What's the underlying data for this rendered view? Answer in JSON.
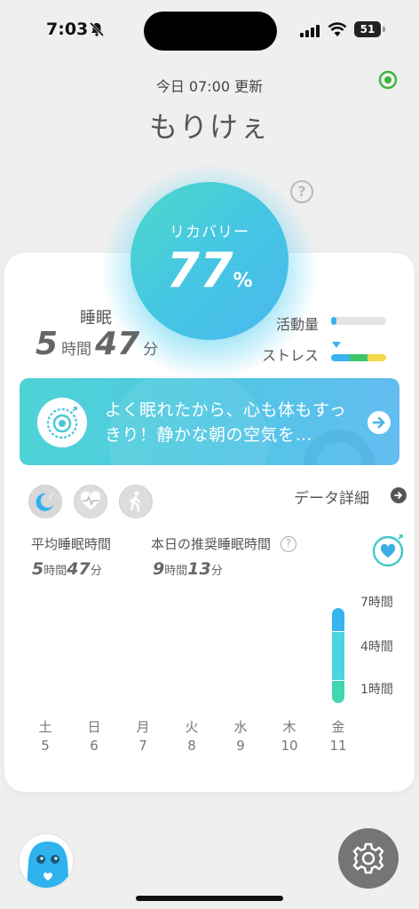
{
  "status_bar": {
    "time": "7:03",
    "battery": "51"
  },
  "header": {
    "update_text": "今日 07:00 更新",
    "username": "もりけぇ",
    "help": "?"
  },
  "recovery": {
    "label": "リカバリー",
    "value": "77",
    "unit": "%",
    "level": 0.77
  },
  "sleep": {
    "label": "睡眠",
    "hours": "5",
    "hours_unit": "時間",
    "minutes": "47",
    "minutes_unit": "分"
  },
  "activity": {
    "label": "活動量",
    "level": 0.1
  },
  "stress": {
    "label": "ストレス",
    "segment_colors": [
      "#3ab3ee",
      "#3cc46a",
      "#f2d94a"
    ]
  },
  "banner": {
    "message": "よく眠れたから、心も体もすっきり！静かな朝の空気を…"
  },
  "tabs": [
    {
      "icon": "sleep-moon-icon",
      "active": true
    },
    {
      "icon": "heart-rate-icon",
      "active": false
    },
    {
      "icon": "walking-icon",
      "active": false
    }
  ],
  "data_detail": {
    "label": "データ詳細"
  },
  "stats": {
    "avg_sleep": {
      "label": "平均睡眠時間",
      "hours": "5",
      "hours_unit": "時間",
      "minutes": "47",
      "minutes_unit": "分"
    },
    "recommended": {
      "label": "本日の推奨睡眠時間",
      "hours": "9",
      "hours_unit": "時間",
      "minutes": "13",
      "minutes_unit": "分"
    }
  },
  "chart_data": {
    "type": "bar",
    "ylabels": [
      "7時間",
      "4時間",
      "1時間"
    ],
    "days": [
      {
        "day": "土",
        "date": "5",
        "hours": null
      },
      {
        "day": "日",
        "date": "6",
        "hours": null
      },
      {
        "day": "月",
        "date": "7",
        "hours": null
      },
      {
        "day": "火",
        "date": "8",
        "hours": null
      },
      {
        "day": "水",
        "date": "9",
        "hours": null
      },
      {
        "day": "木",
        "date": "10",
        "hours": null
      },
      {
        "day": "金",
        "date": "11",
        "hours": 7.3
      }
    ],
    "stage_colors": [
      "#38b4ee",
      "#4cd3e0",
      "#3fd6b0"
    ]
  },
  "colors": {
    "accent": "#45c6e4",
    "teal": "#4fd8c8",
    "settings_bg": "#757575"
  }
}
